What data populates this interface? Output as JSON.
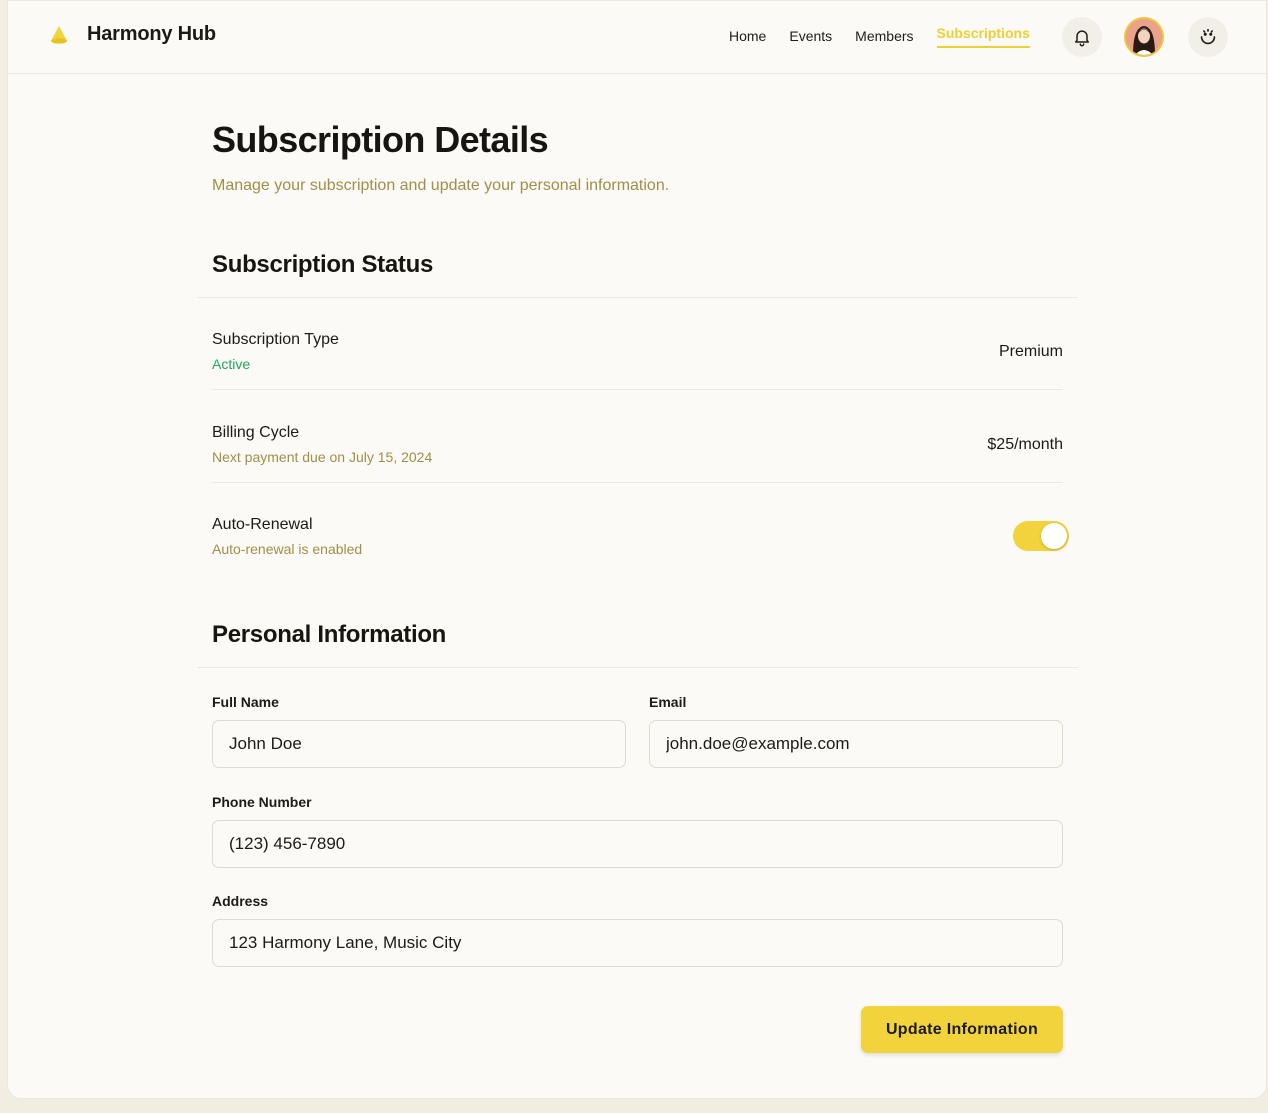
{
  "app": {
    "name": "Harmony Hub",
    "logo_icon": "cone-logo-icon",
    "accent": "#f3d33b"
  },
  "nav": {
    "items": [
      {
        "label": "Home"
      },
      {
        "label": "Events"
      },
      {
        "label": "Members"
      },
      {
        "label": "Subscriptions",
        "active": true
      }
    ],
    "icons": [
      "bell-icon",
      "avatar",
      "smile-icon"
    ]
  },
  "page": {
    "title": "Subscription Details",
    "subtitle": "Manage your subscription and update your personal information."
  },
  "status_section": {
    "title": "Subscription Status",
    "rows": [
      {
        "label": "Subscription Type",
        "desc": "Active",
        "value": "Premium"
      },
      {
        "label": "Billing Cycle",
        "desc": "Next payment due on July 15, 2024",
        "value": "$25/month"
      },
      {
        "label": "Auto-Renewal",
        "desc": "Auto-renewal is enabled",
        "toggle_on": true
      }
    ]
  },
  "personal_section": {
    "title": "Personal Information",
    "full_name_label": "Full Name",
    "full_name_value": "John Doe",
    "email_label": "Email",
    "email_value": "john.doe@example.com",
    "phone_label": "Phone Number",
    "phone_value": "(123) 456-7890",
    "address_label": "Address",
    "address_value": "123 Harmony Lane, Music City"
  },
  "actions": {
    "update_label": "Update Information"
  }
}
